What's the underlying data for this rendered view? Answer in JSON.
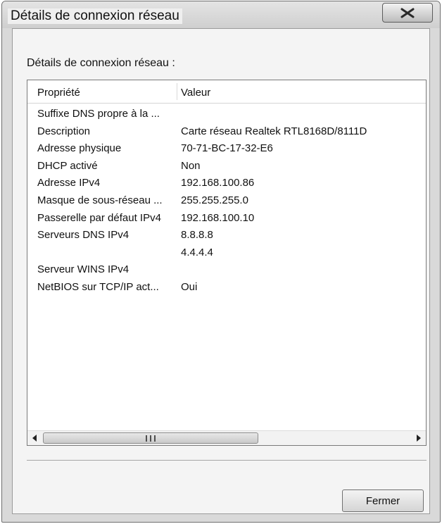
{
  "window": {
    "title": "Détails de connexion réseau"
  },
  "content": {
    "section_label": "Détails de connexion réseau :",
    "columns": [
      "Propriété",
      "Valeur"
    ],
    "rows": [
      {
        "property": "Suffixe DNS propre à la ...",
        "value": ""
      },
      {
        "property": "Description",
        "value": "Carte réseau Realtek RTL8168D/8111D"
      },
      {
        "property": "Adresse physique",
        "value": "70-71-BC-17-32-E6"
      },
      {
        "property": "DHCP activé",
        "value": "Non"
      },
      {
        "property": "Adresse IPv4",
        "value": "192.168.100.86"
      },
      {
        "property": "Masque de sous-réseau ...",
        "value": "255.255.255.0"
      },
      {
        "property": "Passerelle par défaut IPv4",
        "value": "192.168.100.10"
      },
      {
        "property": "Serveurs DNS IPv4",
        "value": "8.8.8.8"
      },
      {
        "property": "",
        "value": "4.4.4.4"
      },
      {
        "property": "Serveur WINS IPv4",
        "value": ""
      },
      {
        "property": "NetBIOS sur TCP/IP act...",
        "value": "Oui"
      }
    ]
  },
  "footer": {
    "close_label": "Fermer"
  },
  "icons": {
    "close": "close-icon",
    "left_arrow": "arrow-left-icon",
    "right_arrow": "arrow-right-icon",
    "grip": "grip-icon"
  }
}
